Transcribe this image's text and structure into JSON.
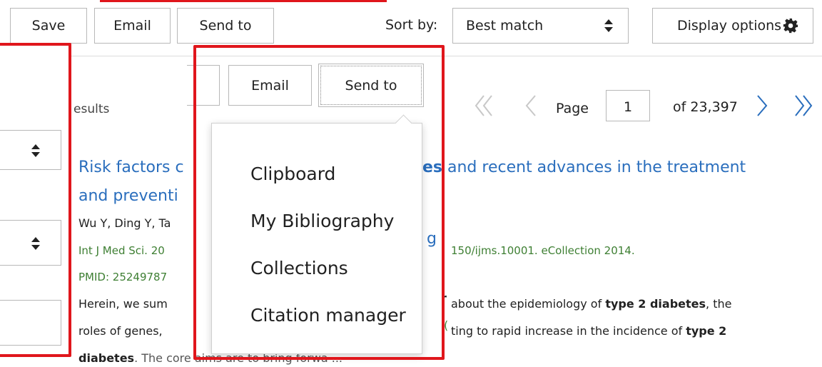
{
  "toolbar_top": {
    "save_label": "Save",
    "email_label": "Email",
    "send_to_label": "Send to",
    "sort_by_label": "Sort by:",
    "sort_value": "Best match",
    "display_options_label": "Display options"
  },
  "toolbar_inner": {
    "email_label": "Email",
    "send_to_label": "Send to"
  },
  "results_partial": "esults",
  "pagination": {
    "page_label": "Page",
    "page_value": "1",
    "of_label": "of 23,397"
  },
  "send_to_menu": {
    "items": [
      "Clipboard",
      "My Bibliography",
      "Collections",
      "Citation manager"
    ]
  },
  "result": {
    "title_a": "Risk factors c",
    "title_b_bold": "es",
    "title_c": " and recent advances in the treatment",
    "title_line2": "and preventi",
    "authors": "Wu Y, Ding Y, Ta",
    "peek_fragment": "g",
    "citation_a": "Int J Med Sci. 20",
    "citation_b": "150/ijms.10001. eCollection 2014.",
    "pmid": "PMID: 25249787",
    "snippet1_a": "Herein, we sum",
    "snippet1_peek": "r",
    "snippet1_b": "about the epidemiology of ",
    "snippet1_bold": "type 2 diabetes",
    "snippet1_c": ", the",
    "snippet2_a": "roles of genes,",
    "snippet2_peek": "(",
    "snippet2_b": "ting to rapid increase in the incidence of ",
    "snippet2_bold": "type 2",
    "snippet3_bold": "diabetes",
    "snippet3_rest": ". The core aims are to bring forwa ..."
  },
  "colors": {
    "highlight_border": "#e0161c",
    "link": "#2a6ebd",
    "journal_text": "#3e7f33"
  }
}
